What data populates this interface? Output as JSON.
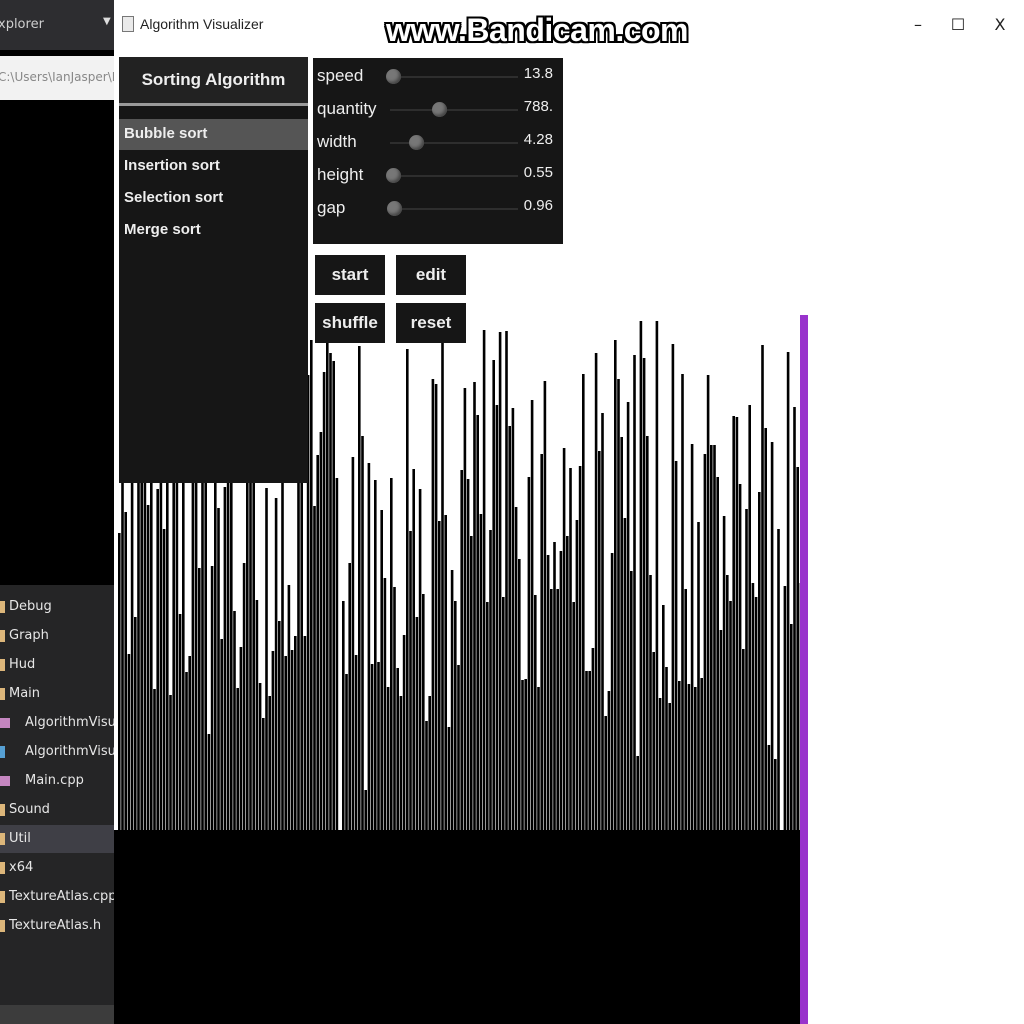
{
  "ide": {
    "title": "xplorer",
    "path": "C:\\Users\\IanJasper\\Prog",
    "tree": [
      {
        "label": "Debug",
        "type": "folder"
      },
      {
        "label": "Graph",
        "type": "folder"
      },
      {
        "label": "Hud",
        "type": "folder"
      },
      {
        "label": "Main",
        "type": "folder"
      },
      {
        "label": "AlgorithmVisualiser",
        "type": "cpp"
      },
      {
        "label": "AlgorithmVisualiser",
        "type": "header"
      },
      {
        "label": "Main.cpp",
        "type": "cpp"
      },
      {
        "label": "Sound",
        "type": "folder"
      },
      {
        "label": "Util",
        "type": "folder",
        "selected": true
      },
      {
        "label": "x64",
        "type": "folder"
      },
      {
        "label": "TextureAtlas.cpp",
        "type": "folder"
      },
      {
        "label": "TextureAtlas.h",
        "type": "folder"
      }
    ]
  },
  "window": {
    "title": "Algorithm Visualizer",
    "minimize": "–",
    "maximize": "☐",
    "close": "X"
  },
  "watermark": "www.Bandicam.com",
  "algorithms": {
    "header": "Sorting Algorithm",
    "items": [
      "Bubble sort",
      "Insertion sort",
      "Selection sort",
      "Merge sort"
    ],
    "active_index": 0
  },
  "sliders": [
    {
      "label": "speed",
      "value": "13.8",
      "level": 0.02
    },
    {
      "label": "quantity",
      "value": "788.",
      "level": 0.38
    },
    {
      "label": "width",
      "value": "4.28",
      "level": 0.2
    },
    {
      "label": "height",
      "value": "0.55",
      "level": 0.02
    },
    {
      "label": "gap",
      "value": "0.96",
      "level": 0.03
    }
  ],
  "buttons": {
    "start": "start",
    "edit": "edit",
    "shuffle": "shuffle",
    "reset": "reset"
  },
  "colors": {
    "bar": "#000000",
    "highlight_bar": "#9933cc",
    "panel": "#161616",
    "active_item": "#555555"
  }
}
